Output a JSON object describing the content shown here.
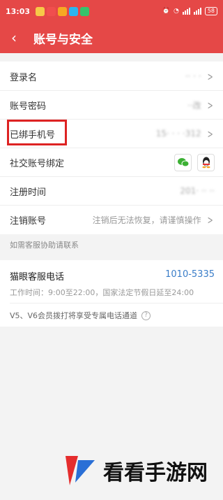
{
  "status_bar": {
    "time": "13:03",
    "battery": "58"
  },
  "nav": {
    "title": "账号与安全",
    "back_label": "‹"
  },
  "rows": {
    "login_name": {
      "label": "登录名",
      "value": "·· · ·"
    },
    "password": {
      "label": "账号密码",
      "value": "··改"
    },
    "phone": {
      "label": "已绑手机号",
      "value": "15· · · ·312"
    },
    "social": {
      "label": "社交账号绑定"
    },
    "register_time": {
      "label": "注册时间",
      "value": "201· ·· ··"
    },
    "cancel_account": {
      "label": "注销账号",
      "value": "注销后无法恢复，请谨慎操作"
    }
  },
  "service": {
    "section_label": "如需客服协助请联系",
    "title": "猫眼客服电话",
    "phone": "1010-5335",
    "hours": "工作时间：9:00至22:00，国家法定节假日延至24:00",
    "vip_text": "V5、V6会员拨打将享受专属电话通道",
    "help_icon": "?"
  },
  "watermark": {
    "text": "看看手游网"
  },
  "colors": {
    "accent": "#e54847",
    "link": "#3a7dc8",
    "highlight": "#dd2222"
  }
}
